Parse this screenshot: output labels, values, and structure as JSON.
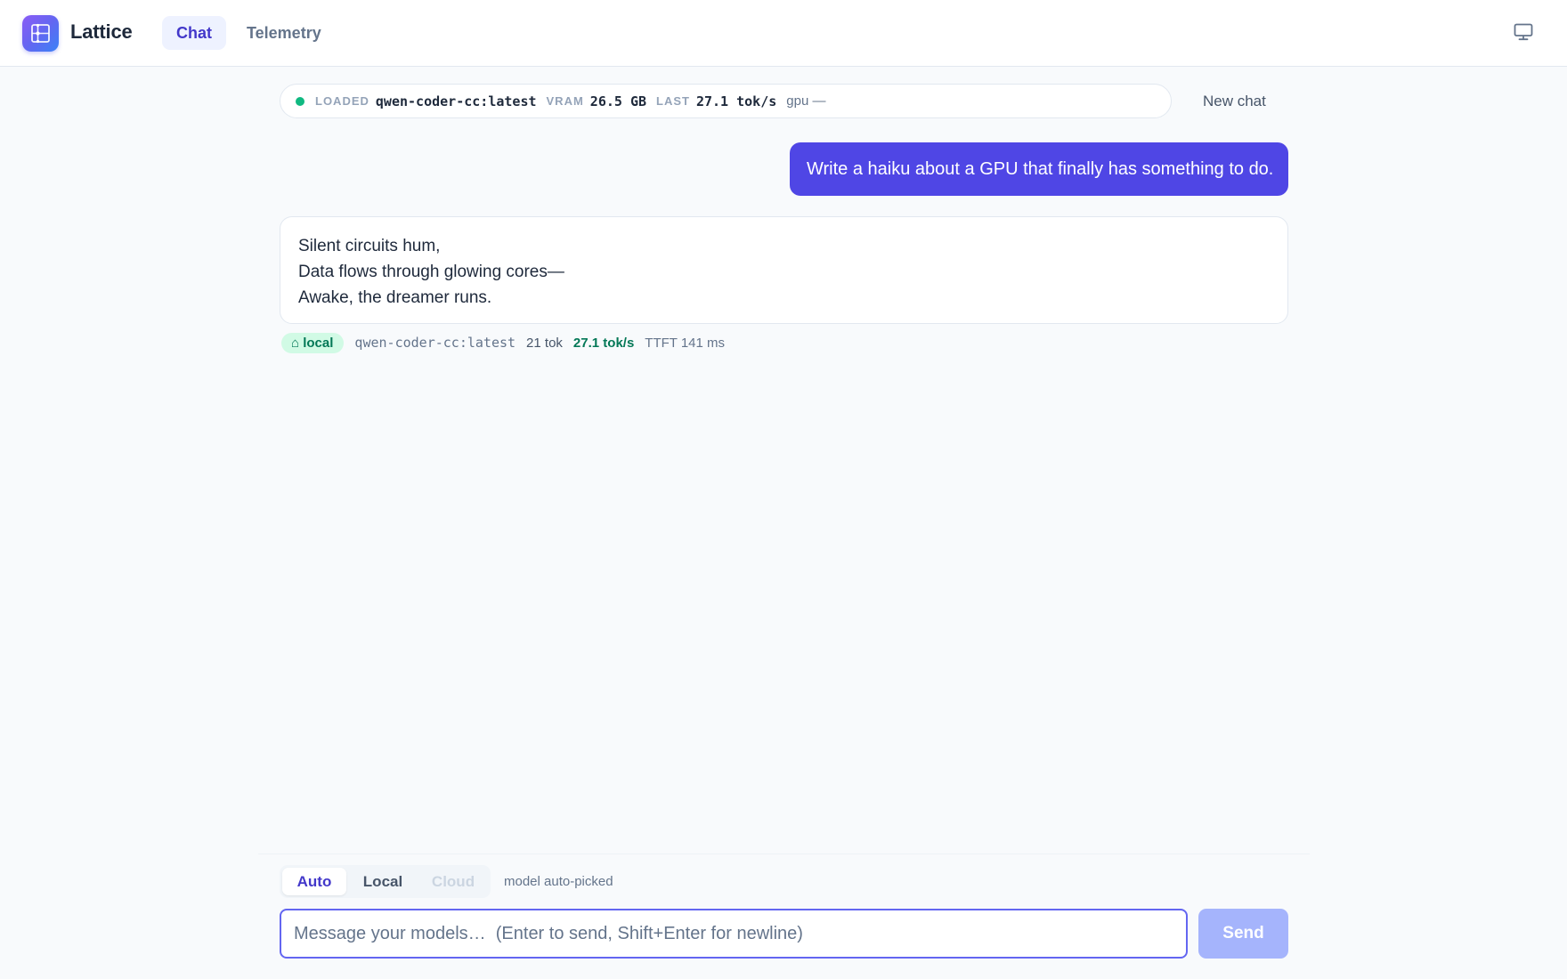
{
  "app": {
    "name": "Lattice",
    "logo_icon": "grid-icon",
    "accent_color": "#4f46e5"
  },
  "nav": {
    "tabs": [
      {
        "label": "Chat",
        "active": true
      },
      {
        "label": "Telemetry",
        "active": false
      }
    ],
    "display_icon": "monitor-icon"
  },
  "status": {
    "indicator_color": "#10b981",
    "loaded_label": "LOADED",
    "loaded_value": "qwen-coder-cc:latest",
    "vram_label": "VRAM",
    "vram_value": "26.5 GB",
    "last_label": "LAST",
    "last_value": "27.1 tok/s",
    "gpu_text": "gpu —"
  },
  "actions": {
    "new_chat": "New chat"
  },
  "conversation": {
    "user_message": "Write a haiku about a GPU that finally has something to do.",
    "assistant_lines": [
      "Silent circuits hum,",
      "Data flows through glowing cores—",
      "Awake, the dreamer runs."
    ],
    "meta": {
      "badge": "⌂ local",
      "model": "qwen-coder-cc:latest",
      "tokens": "21 tok",
      "speed": "27.1 tok/s",
      "ttft": "TTFT 141 ms"
    }
  },
  "composer": {
    "modes": [
      {
        "label": "Auto",
        "selected": true
      },
      {
        "label": "Local",
        "selected": false
      },
      {
        "label": "Cloud",
        "selected": false,
        "disabled": true
      }
    ],
    "mode_hint": "model auto-picked",
    "placeholder": "Message your models…  (Enter to send, Shift+Enter for newline)",
    "send_label": "Send"
  }
}
